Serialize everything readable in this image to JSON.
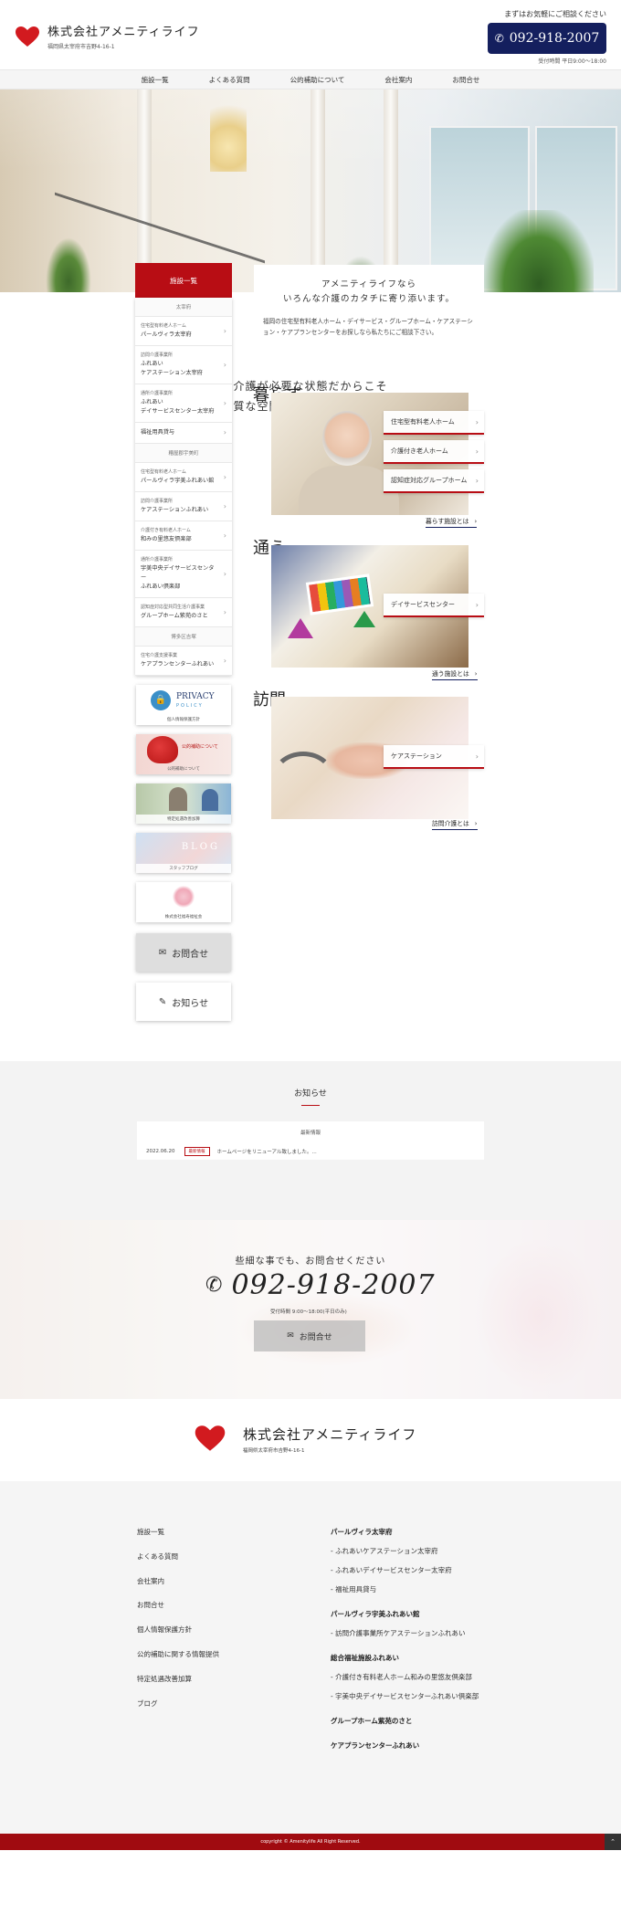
{
  "header": {
    "company": "株式会社アメニティライフ",
    "address": "福岡県太宰府市吉野4-16-1",
    "tagline": "まずはお気軽にご相談ください",
    "tel": "092-918-2007",
    "hours": "受付時間 平日9:00～18:00"
  },
  "nav": [
    "施設一覧",
    "よくある質問",
    "公的補助について",
    "会社案内",
    "お問合せ"
  ],
  "hero": {
    "line1": "介護が必要な状態だからこそ",
    "line2": "上質な空間で過ごすという選択を"
  },
  "intro": {
    "heading1": "アメニティライフなら",
    "heading2": "いろんな介護のカタチに寄り添います。",
    "text": "福岡の住宅型有料老人ホーム・デイサービス・グループホーム・ケアステーション・ケアプランセンターをお探しなら私たちにご相談下さい。"
  },
  "sidebar": {
    "title": "施設一覧",
    "cats": [
      "太宰府",
      "糟屋郡宇美町",
      "博多区吉塚"
    ],
    "items": [
      {
        "sub": "住宅型有料老人ホーム",
        "name": "パールヴィラ太宰府"
      },
      {
        "sub": "訪問介護事業所",
        "name": "ふれあい",
        "name2": "ケアステーション太宰府"
      },
      {
        "sub": "通所介護事業所",
        "name": "ふれあい",
        "name2": "デイサービスセンター太宰府"
      },
      {
        "sub": "",
        "name": "福祉用具貸与"
      },
      {
        "sub": "住宅型有料老人ホーム",
        "name": "パールヴィラ宇美ふれあい館"
      },
      {
        "sub": "訪問介護事業所",
        "name": "ケアステーションふれあい"
      },
      {
        "sub": "介護付き有料老人ホーム",
        "name": "和みの里悠友倶楽部"
      },
      {
        "sub": "通所介護事業所",
        "name": "宇美中央デイサービスセンター",
        "name2": "ふれあい倶楽部"
      },
      {
        "sub": "認知症対応型共同生活介護事業",
        "name": "グループホーム紫苑のさと"
      },
      {
        "sub": "住宅介護支援事業",
        "name": "ケアプランセンターふれあい"
      }
    ],
    "banners": {
      "privacy1": "PRIVACY",
      "privacy2": "POLICY",
      "privacy_cap": "個人情報保護方針",
      "heart_txt": "公的補助について",
      "public_cap": "公的補助について",
      "facility_cap": "特定処遇改善加算",
      "blog": "BLOG",
      "blog_cap": "スタッフブログ",
      "welfare_cap": "株式会社福寿福祉会"
    },
    "contact_btn": "お問合せ",
    "news_btn": "お知らせ"
  },
  "sections": {
    "living": {
      "title": "暮らす",
      "tags": [
        "住宅型有料老人ホーム",
        "介護付き老人ホーム",
        "認知症対応グループホーム"
      ],
      "more": "暮らす施設とは"
    },
    "commute": {
      "title": "通う",
      "tags": [
        "デイサービスセンター"
      ],
      "more": "通う施設とは"
    },
    "visit": {
      "title": "訪問",
      "tags": [
        "ケアステーション"
      ],
      "more": "訪問介護とは"
    }
  },
  "news": {
    "title": "お知らせ",
    "category": "最新情報",
    "date": "2022.06.20",
    "badge": "最新情報",
    "text": "ホームページをリニューアル致しました。..."
  },
  "contact": {
    "tagline": "些細な事でも、お問合せください",
    "tel": "092-918-2007",
    "hours": "受付時間 9:00～18:00(平日のみ)",
    "button": "お問合せ"
  },
  "footer": {
    "company": "株式会社アメニティライフ",
    "address": "福岡県太宰府市吉野4-16-1",
    "col1": [
      "施設一覧",
      "よくある質問",
      "会社案内",
      "お問合せ",
      "個人情報保護方針",
      "公的補助に関する情報提供",
      "特定処遇改善加算",
      "ブログ"
    ],
    "col2": [
      {
        "h": "パールヴィラ太宰府",
        "items": [
          "- ふれあいケアステーション太宰府",
          "- ふれあいデイサービスセンター太宰府",
          "- 福祉用具貸与"
        ]
      },
      {
        "h": "パールヴィラ宇美ふれあい館",
        "items": [
          "- 訪問介護事業所ケアステーションふれあい"
        ]
      },
      {
        "h": "総合福祉施設ふれあい",
        "items": [
          "- 介護付き有料老人ホーム和みの里悠友倶楽部",
          "- 宇美中央デイサービスセンターふれあい倶楽部"
        ]
      },
      {
        "h": "グループホーム紫苑のさと",
        "items": []
      },
      {
        "h": "ケアプランセンターふれあい",
        "items": []
      }
    ],
    "copyright": "copyright © Amenitylife All Right Reserved."
  },
  "colors": {
    "accent": "#b80d14",
    "navy": "#141f5e",
    "footer_bar": "#a00b10"
  }
}
